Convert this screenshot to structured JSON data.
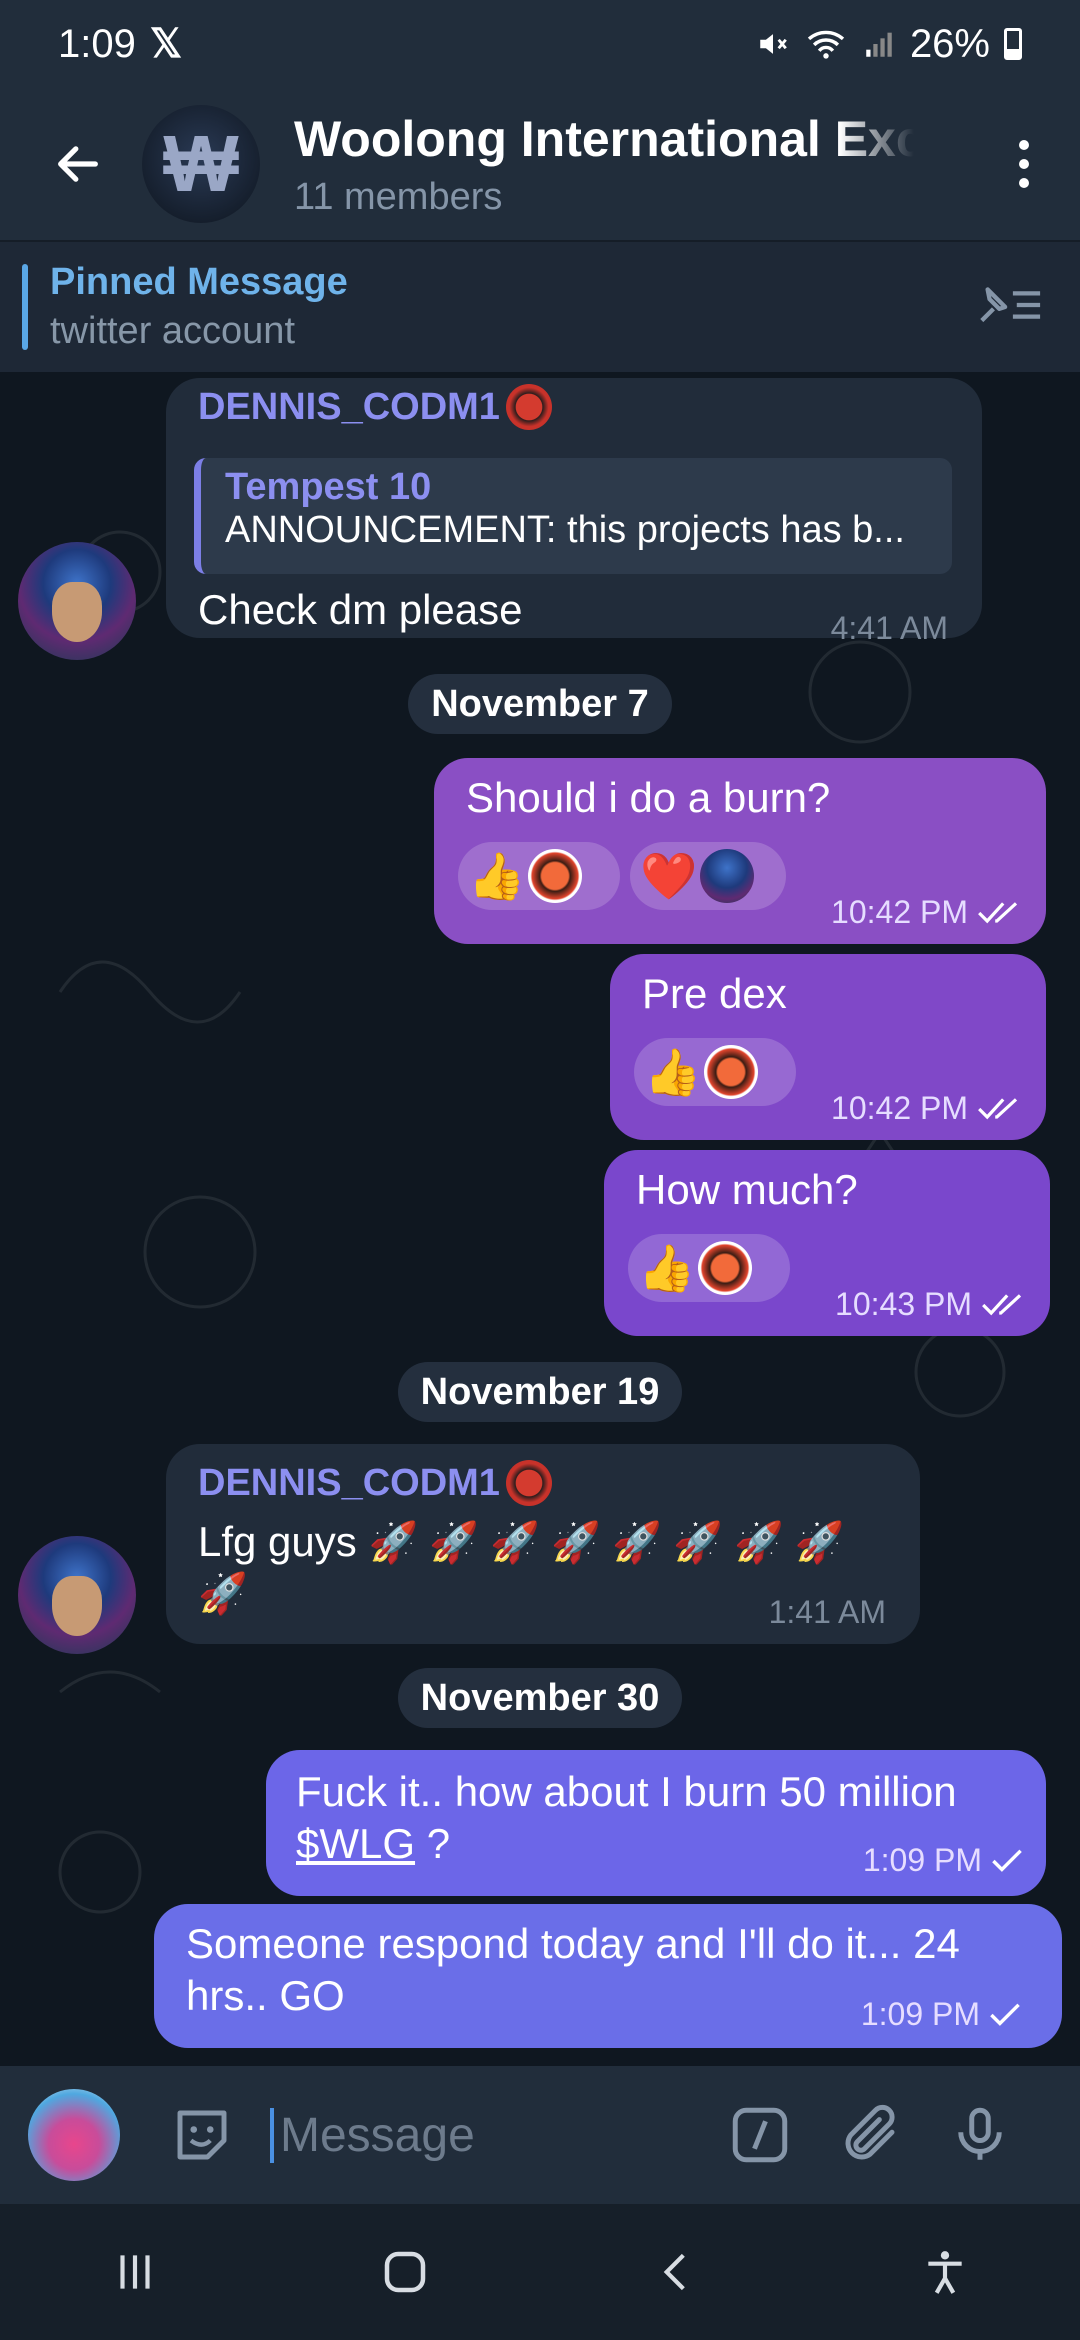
{
  "status_bar": {
    "time": "1:09",
    "x_logo": "𝕏",
    "battery": "26%"
  },
  "header": {
    "title": "Woolong International Exchange",
    "subtitle": "11 members",
    "avatar_letter": "₩"
  },
  "pinned": {
    "title": "Pinned Message",
    "text": "twitter account"
  },
  "messages": {
    "m1": {
      "sender": "DENNIS_CODM1",
      "reply_name": "Tempest 10",
      "reply_text": "ANNOUNCEMENT: this projects has b...",
      "text": "Check dm please",
      "time": "4:41 AM"
    },
    "date1": "November 7",
    "m2": {
      "text": "Should i do a burn?",
      "time": "10:42 PM",
      "reaction1": "👍",
      "reaction2": "❤️"
    },
    "m3": {
      "text": "Pre dex",
      "time": "10:42 PM",
      "reaction1": "👍"
    },
    "m4": {
      "text": "How much?",
      "time": "10:43 PM",
      "reaction1": "👍"
    },
    "date2": "November 19",
    "m5": {
      "sender": "DENNIS_CODM1",
      "text": "Lfg guys",
      "rockets_line1": "🚀 🚀 🚀 🚀 🚀 🚀 🚀 🚀",
      "rockets_line2": "🚀",
      "time": "1:41 AM"
    },
    "date3": "November 30",
    "m6": {
      "text_line1": "Fuck it.. how about I burn 50 million",
      "link": "$WLG",
      "text_after_link": " ?",
      "time": "1:09 PM"
    },
    "m7": {
      "text_line1": "Someone respond today and I'll do it... 24",
      "text_line2": "hrs.. GO",
      "time": "1:09 PM"
    }
  },
  "input": {
    "placeholder": "Message"
  },
  "colors": {
    "incoming_bubble": "#212c3a",
    "outgoing_purple": "#8a4fc4",
    "outgoing_blue": "#6a6ee8",
    "accent": "#8c8ff0"
  }
}
